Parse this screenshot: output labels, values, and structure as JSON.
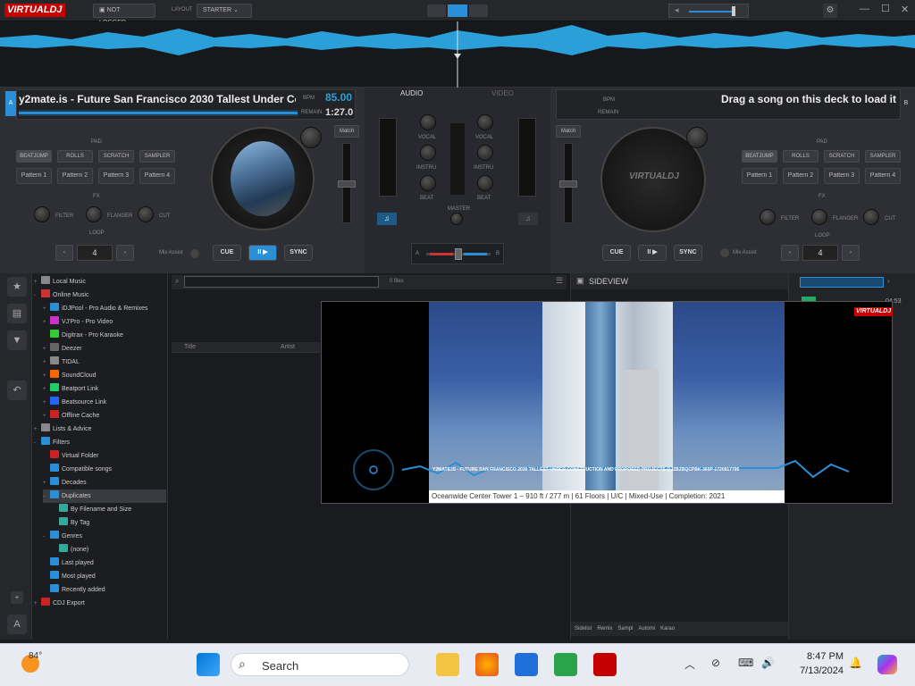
{
  "app": {
    "logo": "VIRTUALDJ",
    "login": "NOT LOGGED...",
    "layout_label": "LAYOUT",
    "layout_value": "STARTER"
  },
  "window": {
    "minimize": "—",
    "maximize": "☐",
    "close": "✕"
  },
  "deckA": {
    "letter": "A",
    "title": "y2mate.is - Future San Francisco 2030 Tallest Under Co",
    "bpm_label": "BPM",
    "bpm": "85.00",
    "remain_label": "REMAIN",
    "remain": "1:27.0",
    "pads_label": "PAD",
    "pad_modes": [
      "BEATJUMP",
      "ROLLS",
      "SCRATCH",
      "SAMPLER"
    ],
    "patterns": [
      "Pattern 1",
      "Pattern 2",
      "Pattern 3",
      "Pattern 4"
    ],
    "fx_label": "FX",
    "fx": [
      "FILTER",
      "FLANGER",
      "CUT"
    ],
    "loop_label": "LOOP",
    "loop": "4",
    "mix_assist": "Mix Assist",
    "cue": "CUE",
    "play": "II ▶",
    "sync": "SYNC",
    "match": "Match"
  },
  "deckB": {
    "letter": "B",
    "message": "Drag a song on this deck to load it",
    "bpm_label": "BPM",
    "remain_label": "REMAIN",
    "pads_label": "PAD",
    "pad_modes": [
      "BEATJUMP",
      "ROLLS",
      "SCRATCH",
      "SAMPLER"
    ],
    "patterns": [
      "Pattern 1",
      "Pattern 2",
      "Pattern 3",
      "Pattern 4"
    ],
    "fx_label": "FX",
    "fx": [
      "FILTER",
      "FLANGER",
      "CUT"
    ],
    "loop_label": "LOOP",
    "loop": "4",
    "mix_assist": "Mix Assist",
    "cue": "CUE",
    "play": "II ▶",
    "sync": "SYNC",
    "match": "Match",
    "platter_logo": "VIRTUALDJ"
  },
  "mixer": {
    "tab_audio": "AUDIO",
    "tab_video": "VIDEO",
    "vocal": "VOCAL",
    "instru": "INSTRU",
    "beat": "BEAT",
    "master": "MASTER",
    "xfader_a": "A",
    "xfader_b": "B"
  },
  "browser": {
    "search_placeholder": "",
    "files_count": "0 files",
    "col_title": "Title",
    "col_artist": "Artist",
    "sideview_title": "SIDEVIEW",
    "side_tabs": [
      "Sidelist",
      "Remix",
      "Sampl",
      "Automi",
      "Karao"
    ],
    "right_time": "04:53"
  },
  "tree": [
    {
      "label": "Local Music",
      "indent": 0,
      "arrow": "+",
      "color": "#888"
    },
    {
      "label": "Online Music",
      "indent": 0,
      "arrow": "-",
      "color": "#c33"
    },
    {
      "label": "iDJPool - Pro Audio & Remixes",
      "indent": 1,
      "arrow": "+",
      "color": "#2a8fd6"
    },
    {
      "label": "VJ'Pro - Pro Video",
      "indent": 1,
      "arrow": "+",
      "color": "#c3c"
    },
    {
      "label": "Digitrax - Pro Karaoke",
      "indent": 1,
      "arrow": "",
      "color": "#3c3"
    },
    {
      "label": "Deezer",
      "indent": 1,
      "arrow": "+",
      "color": "#666"
    },
    {
      "label": "TIDAL",
      "indent": 1,
      "arrow": "+",
      "color": "#888"
    },
    {
      "label": "SoundCloud",
      "indent": 1,
      "arrow": "+",
      "color": "#f60"
    },
    {
      "label": "Beatport Link",
      "indent": 1,
      "arrow": "+",
      "color": "#2c6"
    },
    {
      "label": "Beatsource Link",
      "indent": 1,
      "arrow": "+",
      "color": "#26f"
    },
    {
      "label": "Offline Cache",
      "indent": 1,
      "arrow": "+",
      "color": "#c22"
    },
    {
      "label": "Lists & Advice",
      "indent": 0,
      "arrow": "+",
      "color": "#888"
    },
    {
      "label": "Filters",
      "indent": 0,
      "arrow": "-",
      "color": "#2a8fd6"
    },
    {
      "label": "Virtual Folder",
      "indent": 1,
      "arrow": "",
      "color": "#c22"
    },
    {
      "label": "Compatible songs",
      "indent": 1,
      "arrow": "",
      "color": "#2a8fd6"
    },
    {
      "label": "Decades",
      "indent": 1,
      "arrow": "+",
      "color": "#2a8fd6"
    },
    {
      "label": "Duplicates",
      "indent": 1,
      "arrow": "-",
      "color": "#2a8fd6",
      "selected": true
    },
    {
      "label": "By Filename and Size",
      "indent": 2,
      "arrow": "",
      "color": "#3a9"
    },
    {
      "label": "By Tag",
      "indent": 2,
      "arrow": "",
      "color": "#3a9"
    },
    {
      "label": "Genres",
      "indent": 1,
      "arrow": "-",
      "color": "#2a8fd6"
    },
    {
      "label": "(none)",
      "indent": 2,
      "arrow": "",
      "color": "#3a9"
    },
    {
      "label": "Last played",
      "indent": 1,
      "arrow": "",
      "color": "#2a8fd6"
    },
    {
      "label": "Most played",
      "indent": 1,
      "arrow": "",
      "color": "#2a8fd6"
    },
    {
      "label": "Recently added",
      "indent": 1,
      "arrow": "",
      "color": "#2a8fd6"
    },
    {
      "label": "CDJ Export",
      "indent": 0,
      "arrow": "+",
      "color": "#c22"
    }
  ],
  "video": {
    "logo": "VIRTUALDJ",
    "ticker": "Y2MATE.IS - FUTURE SAN FRANCISCO 2030 TALLEST UNDER CONSTRUCTION AND PROPOSED PROJECTS-QJZBZBQCPBK-360P-1720917795",
    "caption": "Oceanwide Center Tower 1 – 910 ft / 277 m | 61 Floors | U/C | Mixed-Use | Completion: 2021"
  },
  "taskbar": {
    "weather": "84°",
    "search": "Search",
    "time": "8:47 PM",
    "date": "7/13/2024"
  }
}
